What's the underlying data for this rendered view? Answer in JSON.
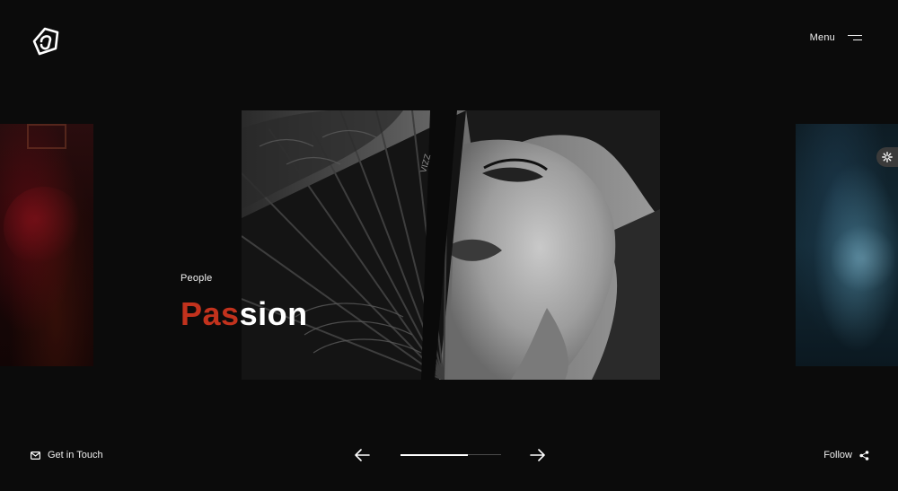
{
  "header": {
    "logo_icon": "brand-logo-icon",
    "menu_label": "Menu",
    "menu_icon": "hamburger-icon"
  },
  "slide": {
    "category": "People",
    "title_accent": "Pas",
    "title_rest": "sion",
    "accent_color": "#c2321d"
  },
  "settings": {
    "icon": "gear-icon"
  },
  "footer": {
    "contact_label": "Get in Touch",
    "contact_icon": "envelope-icon",
    "follow_label": "Follow",
    "follow_icon": "share-icon",
    "prev_icon": "arrow-left-icon",
    "next_icon": "arrow-right-icon",
    "progress": 0.67
  }
}
